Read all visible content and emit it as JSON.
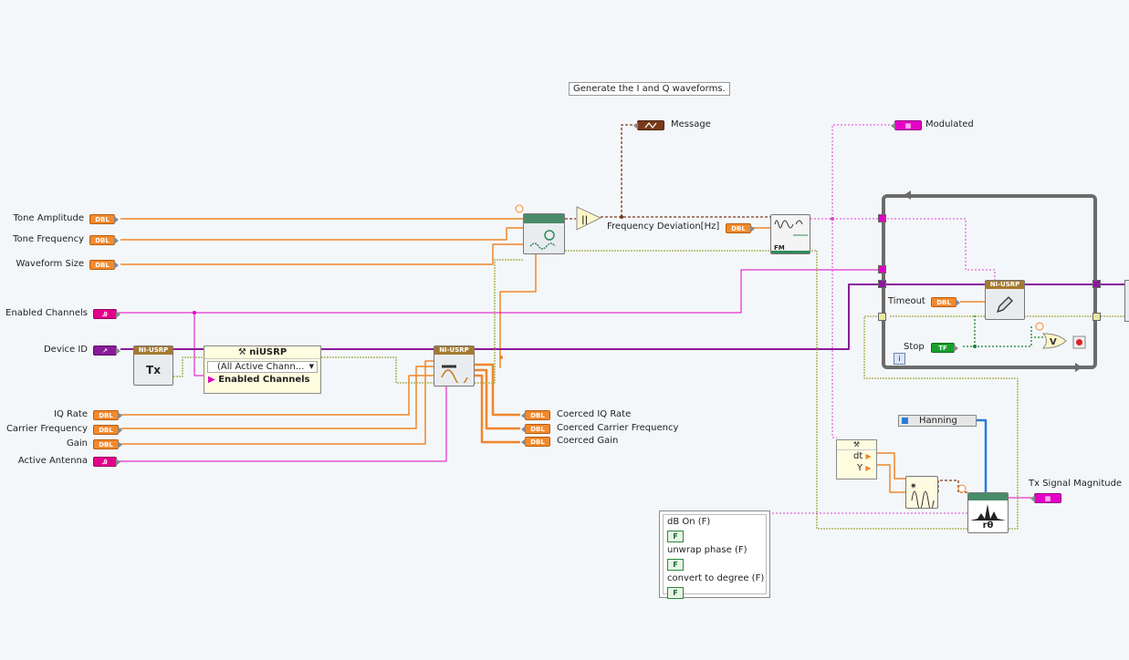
{
  "comment_note": "Generate the I and Q waveforms.",
  "controls": {
    "tone_amplitude": {
      "label": "Tone Amplitude",
      "type": "DBL"
    },
    "tone_frequency": {
      "label": "Tone Frequency",
      "type": "DBL"
    },
    "waveform_size": {
      "label": "Waveform Size",
      "type": "DBL"
    },
    "enabled_channels": {
      "label": "Enabled Channels",
      "type": "Ꭿ"
    },
    "device_id": {
      "label": "Device ID",
      "type": "↗"
    },
    "iq_rate": {
      "label": "IQ Rate",
      "type": "DBL"
    },
    "carrier_frequency": {
      "label": "Carrier Frequency",
      "type": "DBL"
    },
    "gain": {
      "label": "Gain",
      "type": "DBL"
    },
    "active_antenna": {
      "label": "Active Antenna",
      "type": "Ꭿ"
    },
    "frequency_deviation": {
      "label": "Frequency Deviation[Hz]",
      "type": "DBL"
    },
    "timeout": {
      "label": "Timeout",
      "type": "DBL"
    },
    "stop": {
      "label": "Stop",
      "type": "TF"
    }
  },
  "indicators": {
    "message": {
      "label": "Message"
    },
    "modulated": {
      "label": "Modulated"
    },
    "coerced_iq_rate": {
      "label": "Coerced IQ Rate",
      "type": "DBL"
    },
    "coerced_carrier_frequency": {
      "label": "Coerced Carrier Frequency",
      "type": "DBL"
    },
    "coerced_gain": {
      "label": "Coerced Gain",
      "type": "DBL"
    },
    "tx_signal_magnitude": {
      "label": "Tx Signal Magnitude"
    }
  },
  "nodes": {
    "open_tx": {
      "header": "NI-USRP",
      "glyph": "Tx"
    },
    "configure": {
      "header": "NI-USRP"
    },
    "write": {
      "header": "NI-USRP"
    },
    "fm_glyph": "FM",
    "spectrum_glyph": "rθ",
    "property_node": {
      "title": "niUSRP",
      "row1": "(All Active Chann...",
      "row2": "Enabled Channels"
    },
    "waveform_props": {
      "row1": "dt",
      "row2": "Y"
    },
    "window_ring": "Hanning"
  },
  "spectrum_options": {
    "db_on": "dB On (F)",
    "unwrap_phase": "unwrap phase (F)",
    "convert_to_degree": "convert to degree (F)",
    "const_value": "F"
  },
  "loop_iteration": "i"
}
